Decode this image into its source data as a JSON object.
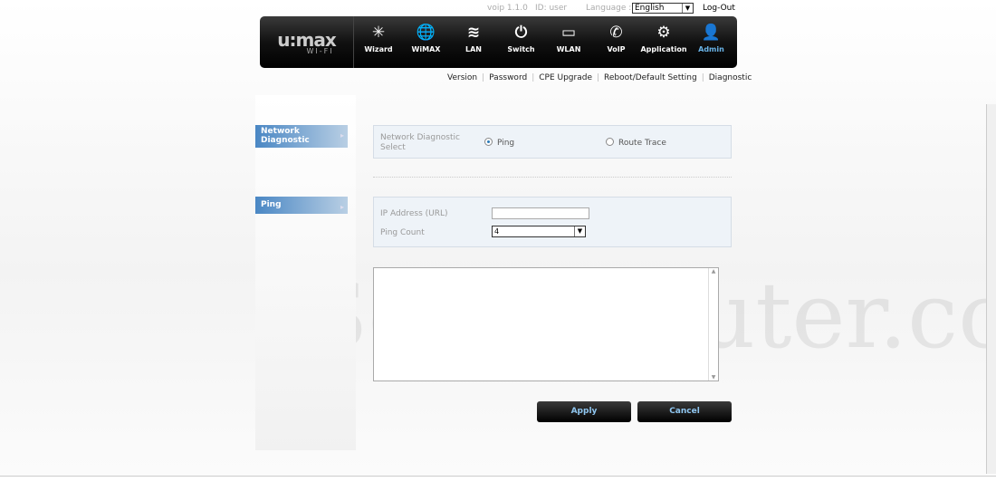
{
  "header": {
    "version": "voip 1.1.0",
    "id": "ID: user",
    "language_label": "Language :",
    "language": "English",
    "logout": "Log-Out"
  },
  "logo": {
    "main": "uimax",
    "sub": "WI-FI"
  },
  "nav": [
    {
      "label": "Wizard",
      "icon": "✳"
    },
    {
      "label": "WiMAX",
      "icon": "🌐"
    },
    {
      "label": "LAN",
      "icon": "≋"
    },
    {
      "label": "Switch",
      "icon": "⏻"
    },
    {
      "label": "WLAN",
      "icon": "▭"
    },
    {
      "label": "VoIP",
      "icon": "✆"
    },
    {
      "label": "Application",
      "icon": "⚙"
    },
    {
      "label": "Admin",
      "icon": "👤"
    }
  ],
  "active_nav": "Admin",
  "subnav": [
    "Version",
    "Password",
    "CPE Upgrade",
    "Reboot/Default Setting",
    "Diagnostic"
  ],
  "sidebar": [
    "Network Diagnostic",
    "Ping"
  ],
  "form": {
    "select_label": "Network Diagnostic Select",
    "opt_ping": "Ping",
    "opt_trace": "Route Trace",
    "ip_label": "IP Address (URL)",
    "ip_value": "",
    "count_label": "Ping Count",
    "count_value": "4",
    "output": ""
  },
  "buttons": {
    "apply": "Apply",
    "cancel": "Cancel"
  },
  "watermark": "SetupRouter.com"
}
